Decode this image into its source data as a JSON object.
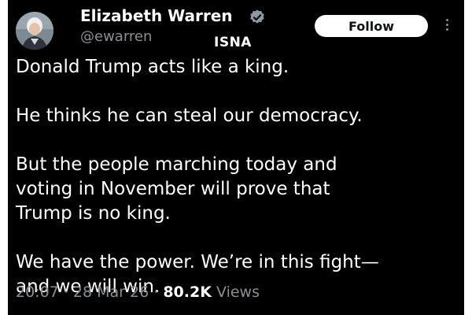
{
  "author": {
    "name": "Elizabeth Warren",
    "handle": "@ewarren",
    "verified": true
  },
  "watermark": "ISNA",
  "follow_label": "Follow",
  "more_icon": "more-vertical-icon",
  "tweet": {
    "paragraphs": [
      "Donald Trump acts like a king.",
      "He thinks he can steal our democracy.",
      "But the people marching today and\nvoting in November will prove that\nTrump is no king.",
      "We have the power. We’re in this fight—\nand we will win."
    ]
  },
  "meta": {
    "time": "20:07",
    "separator": "·",
    "date": "28 Mar 26",
    "views_count": "80.2K",
    "views_label": "Views"
  },
  "colors": {
    "background": "#000000",
    "text": "#ffffff",
    "secondary_text": "#8a8f95",
    "verified": "#8b98a5"
  }
}
